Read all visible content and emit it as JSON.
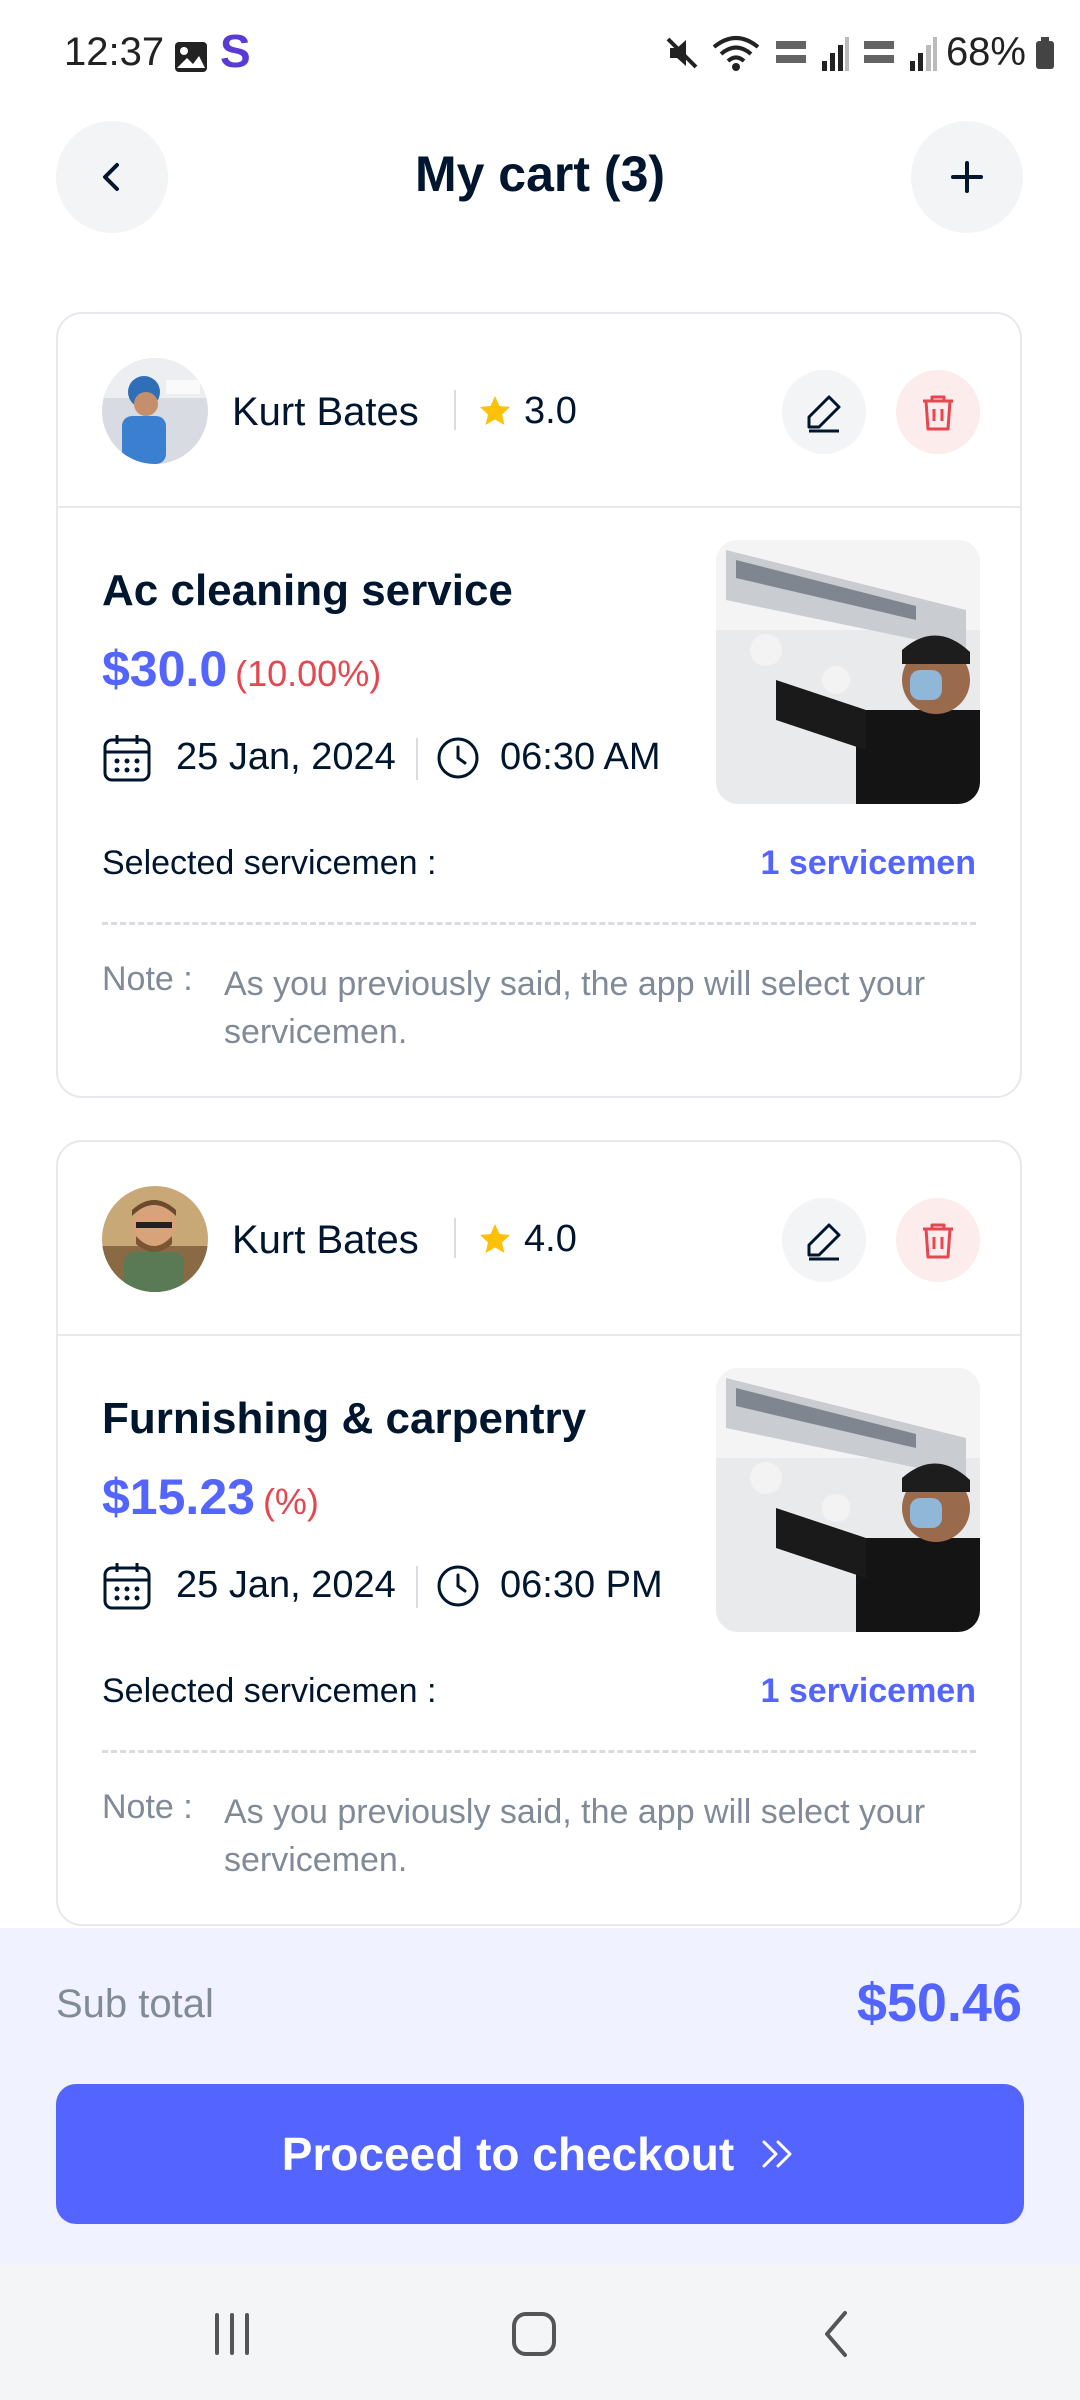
{
  "status_bar": {
    "time": "12:37",
    "app_letter": "S",
    "battery": "68%"
  },
  "header": {
    "title": "My cart (3)"
  },
  "cart": [
    {
      "provider": "Kurt Bates",
      "rating": "3.0",
      "service": "Ac cleaning service",
      "price": "$30.0",
      "discount": "(10.00%)",
      "date": "25 Jan, 2024",
      "time": "06:30 AM",
      "selected_label": "Selected servicemen :",
      "selected_value": "1 servicemen",
      "note_label": "Note :",
      "note_text": "As you previously said, the app will select your servicemen."
    },
    {
      "provider": "Kurt Bates",
      "rating": "4.0",
      "service": "Furnishing & carpentry",
      "price": "$15.23",
      "discount": "(%)",
      "date": "25 Jan, 2024",
      "time": "06:30 PM",
      "selected_label": "Selected servicemen :",
      "selected_value": "1 servicemen",
      "note_label": "Note :",
      "note_text": "As you previously said, the app will select your servicemen."
    }
  ],
  "summary": {
    "subtotal_label": "Sub total",
    "subtotal_value": "$50.46"
  },
  "checkout": {
    "label": "Proceed to checkout"
  },
  "colors": {
    "accent": "#5465ff",
    "danger": "#e5464f",
    "title": "#00162e",
    "muted": "#808b97"
  }
}
